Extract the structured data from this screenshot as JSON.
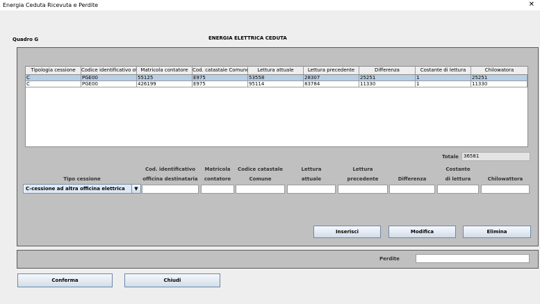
{
  "window": {
    "title": "Energia Ceduta Ricevuta e Perdite",
    "close_glyph": "✕"
  },
  "section_label": "Quadro G",
  "heading": "ENERGIA ELETTRICA CEDUTA",
  "table": {
    "headers": [
      "Tipologia cessione",
      "Codice identificativo offi...",
      "Matricola contatore",
      "Cod. catastale Comune",
      "Lettura attuale",
      "Lettura precedente",
      "Differenza",
      "Costante di lettura",
      "Chilowatora"
    ],
    "rows": [
      [
        "C",
        "PGE00",
        "55125",
        "E975",
        "53558",
        "28307",
        "25251",
        "1",
        "25251"
      ],
      [
        "C",
        "PGE00",
        "426199",
        "E975",
        "95114",
        "83784",
        "11330",
        "1",
        "11330"
      ]
    ]
  },
  "totale": {
    "label": "Totale",
    "value": "36581"
  },
  "form": {
    "labels": {
      "tipo": "Tipo cessione",
      "cod_1": "Cod. identificativo",
      "cod_2": "officina destinataria",
      "matr_1": "Matricola",
      "matr_2": "contatore",
      "catastale_1": "Codice catastale",
      "catastale_2": "Comune",
      "lett_att_1": "Lettura",
      "lett_att_2": "attuale",
      "lett_prec_1": "Lettura",
      "lett_prec_2": "precedente",
      "differenza": "Differenza",
      "costante_1": "Costante",
      "costante_2": "di lettura",
      "chilowattora": "Chilowattora"
    },
    "tipo_cessione_value": "C-cessione ad altra officina elettrica",
    "dropdown_glyph": "▼"
  },
  "buttons": {
    "inserisci": "Inserisci",
    "modifica": "Modifica",
    "elimina": "Elimina",
    "conferma": "Conferma",
    "chiudi": "Chiudi"
  },
  "perdite": {
    "label": "Perdite",
    "value": ""
  },
  "icons": {
    "close": "close-icon",
    "dropdown": "chevron-down-icon"
  }
}
